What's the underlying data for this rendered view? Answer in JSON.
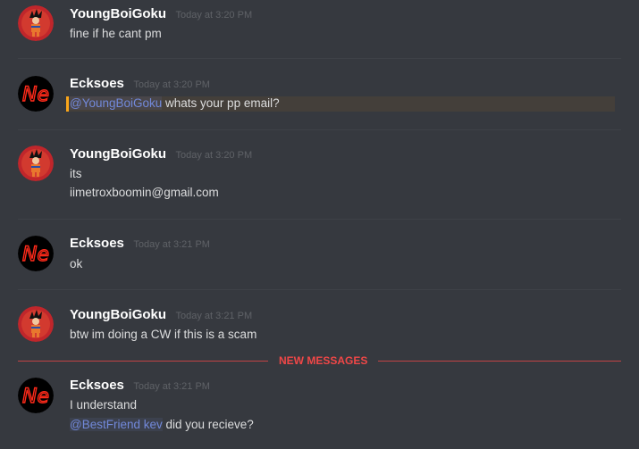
{
  "colors": {
    "background": "#36393f",
    "username": "#ffffff",
    "timestamp": "#5f6267",
    "text": "#dcddde",
    "mention": "#7289da",
    "new_messages": "#f04747",
    "mention_highlight_bar": "#faa61a"
  },
  "messages": [
    {
      "author": "YoungBoiGoku",
      "avatar": "goku-avatar",
      "time": "Today at 3:20 PM",
      "lines": [
        "fine if he cant pm"
      ]
    },
    {
      "author": "Ecksoes",
      "avatar": "ne-avatar",
      "time": "Today at 3:20 PM",
      "mention": "@YoungBoiGoku",
      "lines": [
        " whats your pp email?"
      ]
    },
    {
      "author": "YoungBoiGoku",
      "avatar": "goku-avatar",
      "time": "Today at 3:20 PM",
      "lines": [
        "its",
        "iimetroxboomin@gmail.com"
      ]
    },
    {
      "author": "Ecksoes",
      "avatar": "ne-avatar",
      "time": "Today at 3:21 PM",
      "lines": [
        "ok"
      ]
    },
    {
      "author": "YoungBoiGoku",
      "avatar": "goku-avatar",
      "time": "Today at 3:21 PM",
      "lines": [
        "btw im doing a CW if this is a scam"
      ]
    },
    {
      "author": "Ecksoes",
      "avatar": "ne-avatar",
      "time": "Today at 3:21 PM",
      "lines": [
        "I understand"
      ],
      "mention2": "@BestFriend kev",
      "line2_rest": " did you recieve?"
    }
  ],
  "new_messages_label": "NEW MESSAGES"
}
